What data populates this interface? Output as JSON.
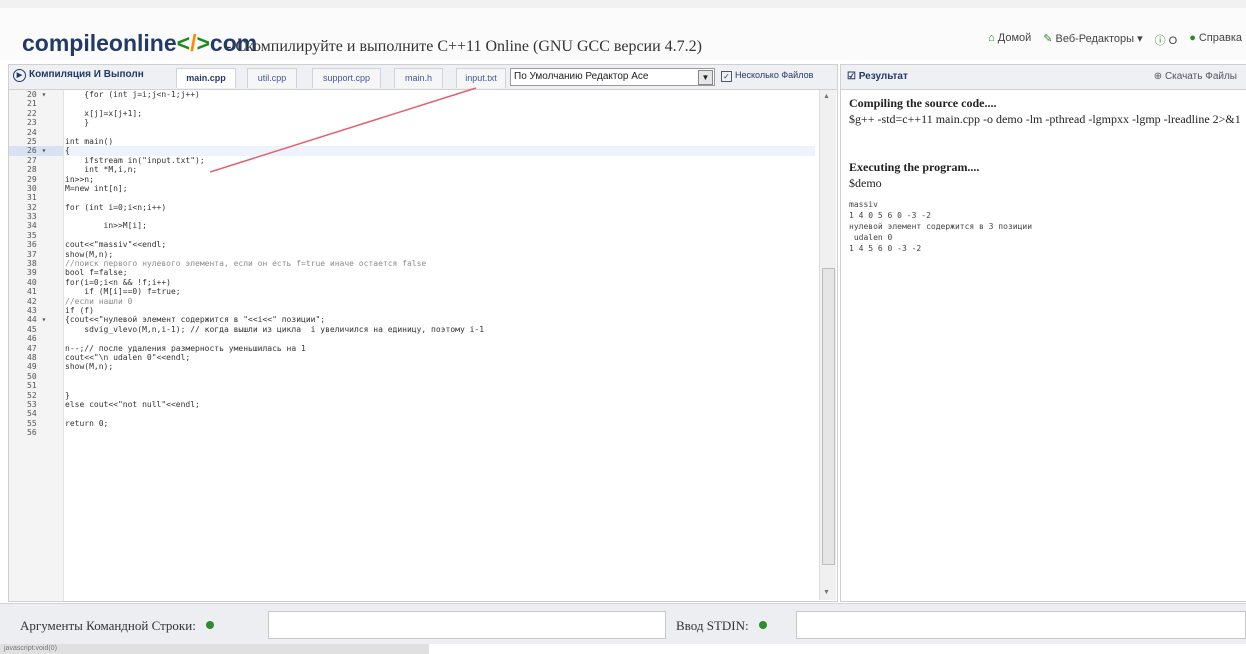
{
  "header": {
    "brand": {
      "part1": "compileonline",
      "lt": "<",
      "slash": "/",
      "gt": ">",
      "part2": "com"
    },
    "subtitle": "- Скомпилируйте и выполните C++11 Online (GNU GCC версии 4.7.2)",
    "nav": [
      "Домой",
      "Веб-Редакторы ▾",
      "О",
      "Справка"
    ]
  },
  "editor": {
    "run_label": "Компиляция И Выполн",
    "tabs": [
      "main.cpp",
      "util.cpp",
      "support.cpp",
      "main.h",
      "input.txt"
    ],
    "editor_select": "По Умолчанию Редактор Ace",
    "multi_files_label": "Несколько Файлов",
    "lines": [
      {
        "n": "20 ▾",
        "t": "    {for (int j=i;j<n-1;j++)"
      },
      {
        "n": "21",
        "t": ""
      },
      {
        "n": "22",
        "t": "    x[j]=x[j+1];"
      },
      {
        "n": "23",
        "t": "    }"
      },
      {
        "n": "24",
        "t": ""
      },
      {
        "n": "25",
        "t": "int main()"
      },
      {
        "n": "26 ▾",
        "t": "{"
      },
      {
        "n": "27",
        "t": "    ifstream in(\"input.txt\");"
      },
      {
        "n": "28",
        "t": "    int *M,i,n;"
      },
      {
        "n": "29",
        "t": "in>>n;"
      },
      {
        "n": "30",
        "t": "M=new int[n];"
      },
      {
        "n": "31",
        "t": ""
      },
      {
        "n": "32",
        "t": "for (int i=0;i<n;i++)"
      },
      {
        "n": "33",
        "t": ""
      },
      {
        "n": "34",
        "t": "        in>>M[i];"
      },
      {
        "n": "35",
        "t": ""
      },
      {
        "n": "36",
        "t": "cout<<\"massiv\"<<endl;"
      },
      {
        "n": "37",
        "t": "show(M,n);"
      },
      {
        "n": "38",
        "t": "//поиск первого нулевого элемента, если он есть f=true иначе остается false"
      },
      {
        "n": "39",
        "t": "bool f=false;"
      },
      {
        "n": "40",
        "t": "for(i=0;i<n && !f;i++)"
      },
      {
        "n": "41",
        "t": "    if (M[i]==0) f=true;"
      },
      {
        "n": "42",
        "t": "//если нашли 0"
      },
      {
        "n": "43",
        "t": "if (f)"
      },
      {
        "n": "44 ▾",
        "t": "{cout<<\"нулевой элемент содержится в \"<<i<<\" позиции\";"
      },
      {
        "n": "45",
        "t": "    sdvig_vlevo(M,n,i-1); // когда вышли из цикла  i увеличился на единицу, поэтому i-1"
      },
      {
        "n": "46",
        "t": ""
      },
      {
        "n": "47",
        "t": "n--;// после удаления размерность уменьшилась на 1"
      },
      {
        "n": "48",
        "t": "cout<<\"\\n udalen 0\"<<endl;"
      },
      {
        "n": "49",
        "t": "show(M,n);"
      },
      {
        "n": "50",
        "t": ""
      },
      {
        "n": "51",
        "t": ""
      },
      {
        "n": "52",
        "t": "}"
      },
      {
        "n": "53",
        "t": "else cout<<\"not null\"<<endl;"
      },
      {
        "n": "54",
        "t": ""
      },
      {
        "n": "55",
        "t": "return 0;"
      },
      {
        "n": "56",
        "t": ""
      }
    ]
  },
  "result": {
    "title": "Результат",
    "download": "Скачать Файлы",
    "compile_heading": "Compiling the source code....",
    "compile_cmd": "$g++ -std=c++11 main.cpp -o demo -lm -pthread -lgmpxx -lgmp -lreadline 2>&1",
    "exec_heading": "Executing the program....",
    "exec_cmd": "$demo",
    "output": "massiv\n1 4 0 5 6 0 -3 -2\nнулевой элемент содержится в 3 позиции\n udalen 0\n1 4 5 6 0 -3 -2"
  },
  "bottom": {
    "args_label": "Аргументы Командной Строки:",
    "stdin_label": "Ввод STDIN:"
  },
  "status_text": "javascript:void(0)"
}
